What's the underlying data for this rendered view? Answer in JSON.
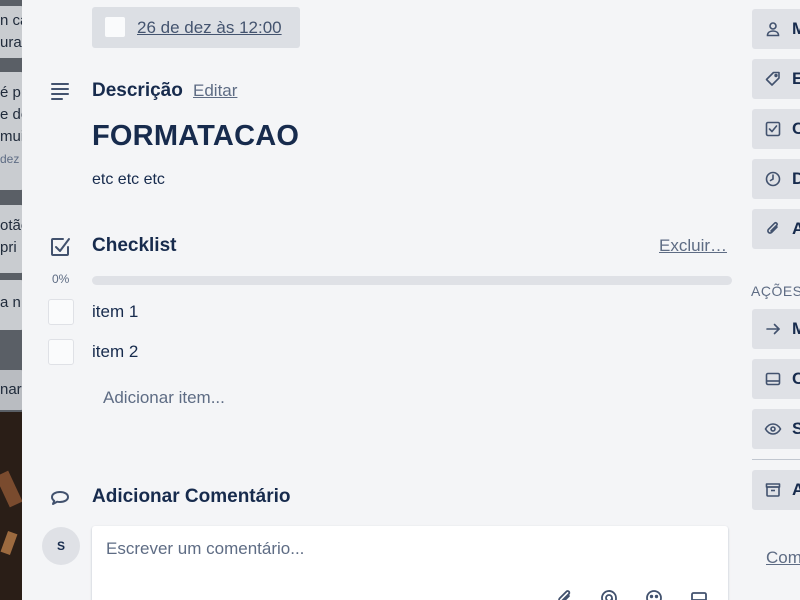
{
  "background": {
    "cards": [
      {
        "lines": [
          "n ca",
          "ura"
        ]
      },
      {
        "lines": [
          "é p",
          "e do",
          "mui",
          "dez"
        ]
      },
      {
        "lines": [
          "otão",
          "pri"
        ]
      },
      {
        "lines": [
          "a n"
        ]
      },
      {
        "lines": [
          "nar"
        ]
      }
    ]
  },
  "due": {
    "text": "26 de dez às 12:00"
  },
  "description": {
    "title": "Descrição",
    "edit_label": "Editar",
    "heading": "FORMATACAO",
    "body": "etc etc etc"
  },
  "checklist": {
    "title": "Checklist",
    "delete_label": "Excluir…",
    "percent_label": "0%",
    "progress": 0,
    "items": [
      {
        "label": "item 1",
        "checked": false
      },
      {
        "label": "item 2",
        "checked": false
      }
    ],
    "add_item_label": "Adicionar item..."
  },
  "comment": {
    "title": "Adicionar Comentário",
    "avatar_initial": "S",
    "placeholder": "Escrever um comentário..."
  },
  "sidebar": {
    "add_buttons": [
      {
        "label": "M",
        "icon": "person-icon"
      },
      {
        "label": "E",
        "icon": "tag-icon"
      },
      {
        "label": "C",
        "icon": "checkbox-icon"
      },
      {
        "label": "D",
        "icon": "clock-icon"
      },
      {
        "label": "A",
        "icon": "paperclip-icon"
      }
    ],
    "actions_heading": "AÇÕES",
    "action_buttons": [
      {
        "label": "M",
        "icon": "arrow-right-icon"
      },
      {
        "label": "C",
        "icon": "card-icon"
      },
      {
        "label": "S",
        "icon": "eye-icon"
      }
    ],
    "archive_button": {
      "label": "A",
      "icon": "archive-icon"
    },
    "share_link": "Com"
  },
  "colors": {
    "modal_bg": "#f4f5f7",
    "text": "#172b4d",
    "muted": "#5e6c84",
    "button_bg": "#dfe1e6"
  }
}
